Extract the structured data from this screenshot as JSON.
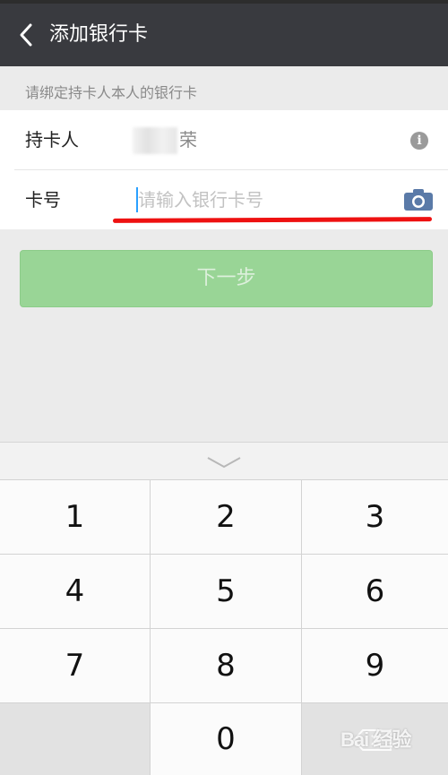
{
  "header": {
    "title": "添加银行卡"
  },
  "form": {
    "hint": "请绑定持卡人本人的银行卡",
    "holder_label": "持卡人",
    "holder_name": "荣",
    "card_label": "卡号",
    "card_placeholder": "请输入银行卡号",
    "card_value": ""
  },
  "actions": {
    "next_label": "下一步"
  },
  "keyboard": {
    "keys": [
      "1",
      "2",
      "3",
      "4",
      "5",
      "6",
      "7",
      "8",
      "9",
      "0"
    ]
  },
  "watermark": "Bai 经验",
  "colors": {
    "topbar": "#393a3f",
    "next_button": "#99d596",
    "annotation_underline": "#ee1111",
    "camera_icon": "#5a7aa8"
  },
  "icons": [
    "back-arrow-icon",
    "info-icon",
    "camera-icon",
    "keyboard-collapse-icon",
    "backspace-icon"
  ]
}
